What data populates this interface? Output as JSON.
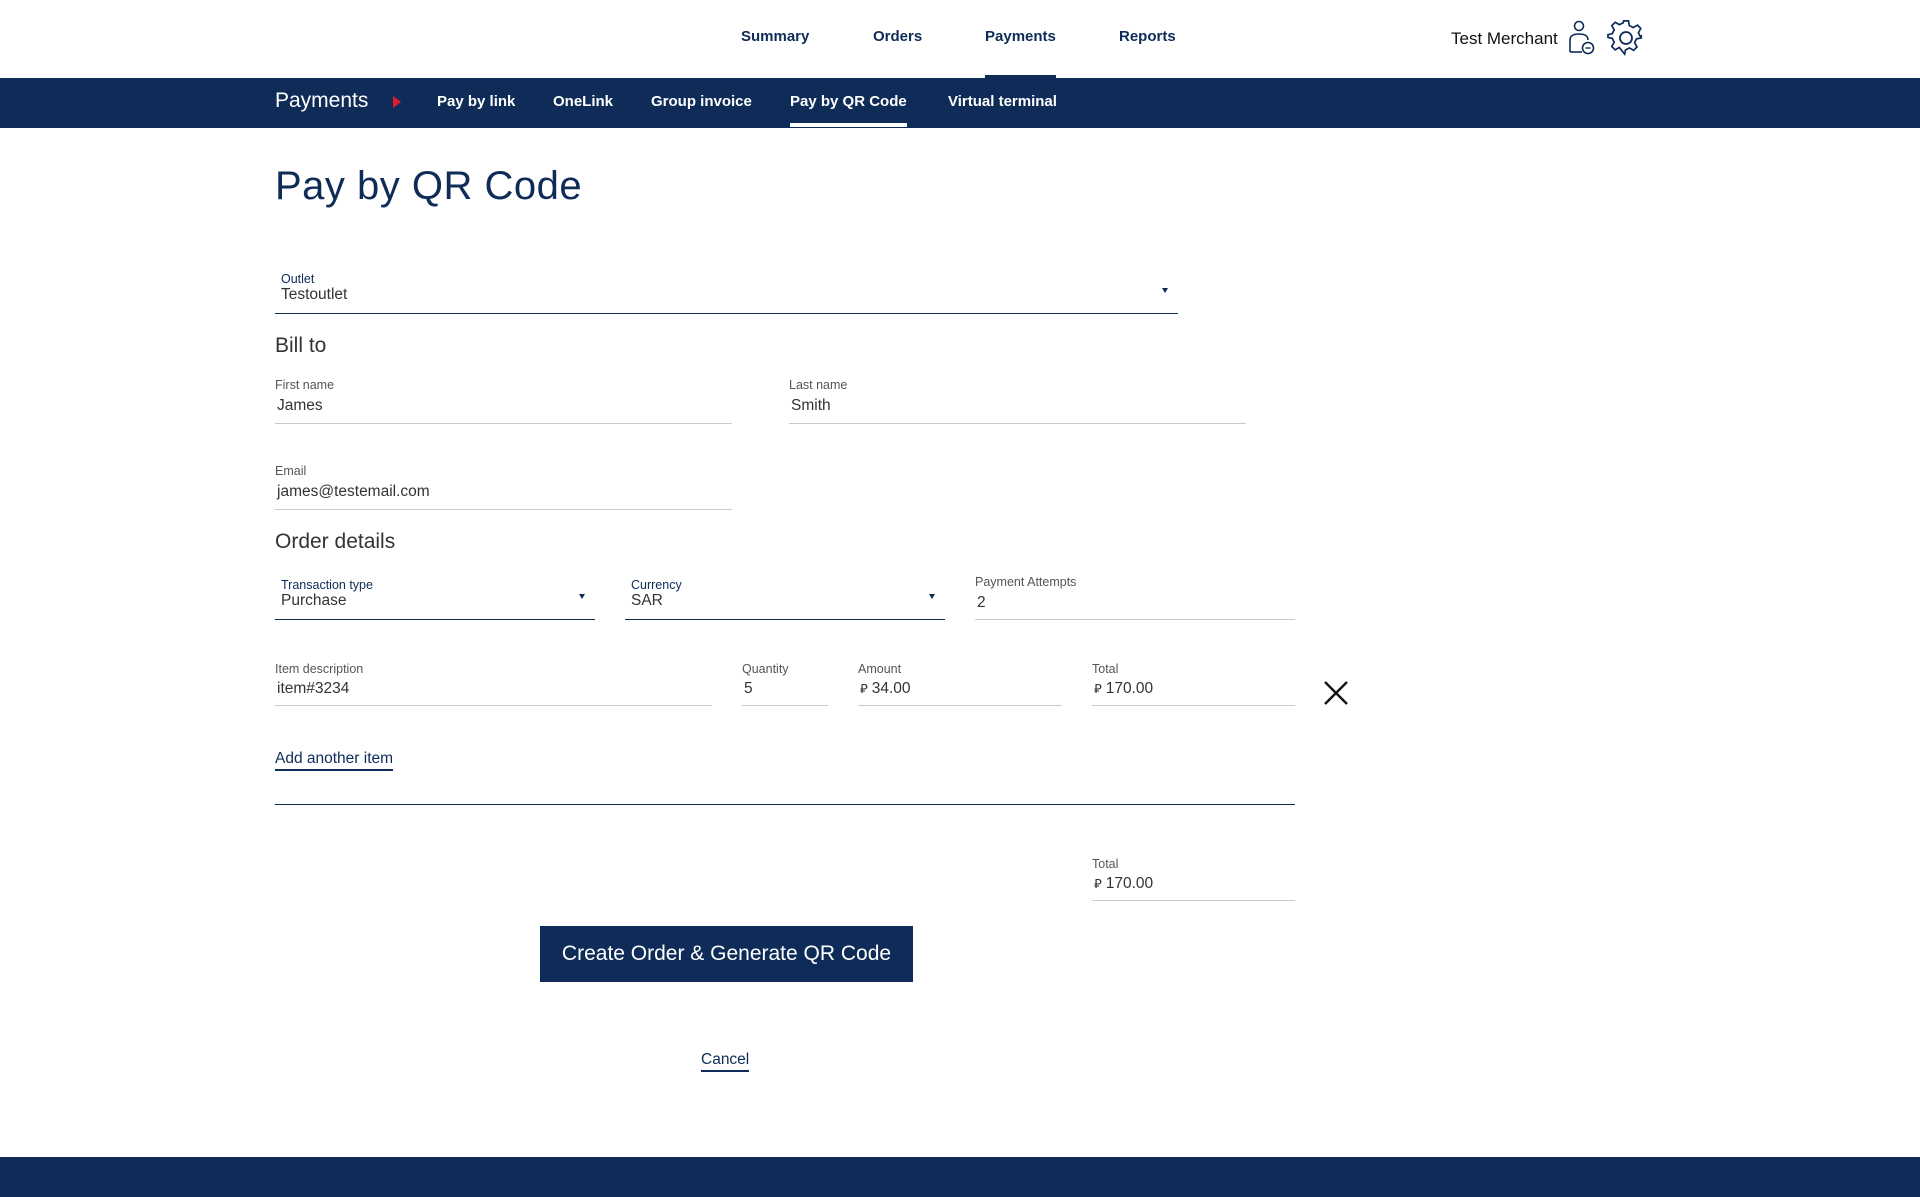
{
  "top_nav": {
    "items": [
      {
        "label": "Summary"
      },
      {
        "label": "Orders"
      },
      {
        "label": "Payments"
      },
      {
        "label": "Reports"
      }
    ],
    "active": "Payments",
    "merchant_name": "Test Merchant",
    "icons": [
      "user-icon",
      "gear-icon"
    ]
  },
  "sub_nav": {
    "section": "Payments",
    "items": [
      {
        "label": "Pay by link"
      },
      {
        "label": "OneLink"
      },
      {
        "label": "Group invoice"
      },
      {
        "label": "Pay by QR Code"
      },
      {
        "label": "Virtual terminal"
      }
    ],
    "active": "Pay by QR Code"
  },
  "page": {
    "title": "Pay by QR Code"
  },
  "outlet": {
    "label": "Outlet",
    "value": "Testoutlet"
  },
  "bill_to": {
    "title": "Bill to",
    "first_name": {
      "label": "First name",
      "value": "James"
    },
    "last_name": {
      "label": "Last name",
      "value": "Smith"
    },
    "email": {
      "label": "Email",
      "value": "james@testemail.com"
    }
  },
  "order_details": {
    "title": "Order details",
    "transaction_type": {
      "label": "Transaction type",
      "value": "Purchase"
    },
    "currency": {
      "label": "Currency",
      "value": "SAR"
    },
    "payment_attempts": {
      "label": "Payment Attempts",
      "value": "2"
    },
    "currency_symbol": "⃁",
    "item": {
      "description": {
        "label": "Item description",
        "value": "item#3234"
      },
      "quantity": {
        "label": "Quantity",
        "value": "5"
      },
      "amount": {
        "label": "Amount",
        "value": "34.00"
      },
      "total": {
        "label": "Total",
        "value": "170.00"
      }
    },
    "add_item_label": "Add another item",
    "grand_total": {
      "label": "Total",
      "value": "170.00"
    }
  },
  "actions": {
    "submit_label": "Create Order & Generate QR Code",
    "cancel_label": "Cancel"
  },
  "colors": {
    "brand_navy": "#0e2c57",
    "accent_red": "#e01b2c"
  }
}
